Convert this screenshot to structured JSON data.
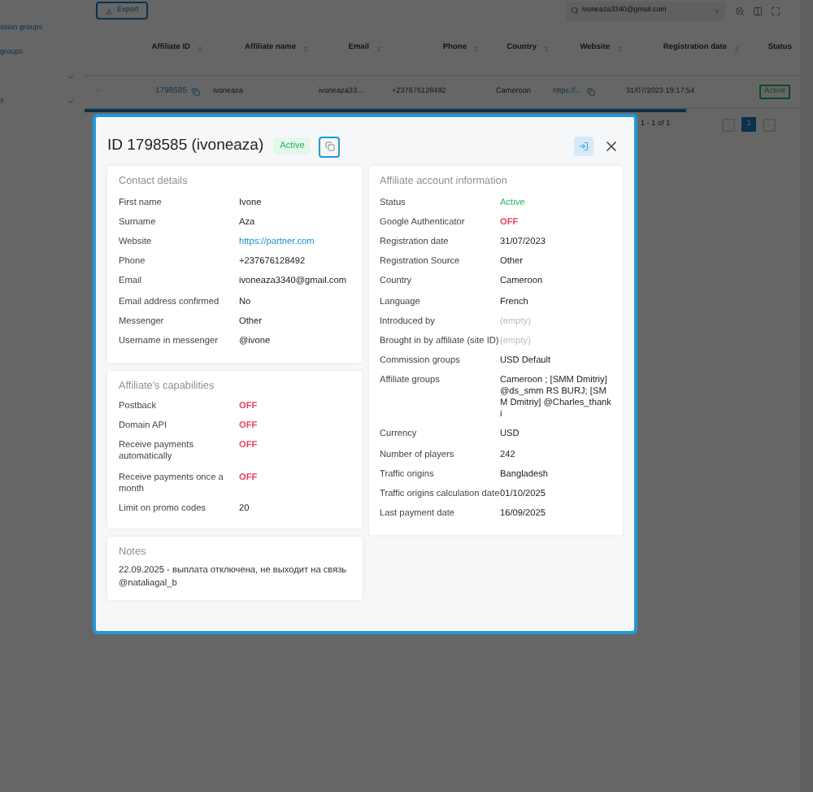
{
  "sidebar": {
    "items": [
      {
        "label": "ssion groups",
        "expandable": false
      },
      {
        "label": "groups",
        "expandable": false
      },
      {
        "expandable": true
      },
      {
        "label": "s",
        "expandable": true
      }
    ]
  },
  "toolbar": {
    "export": "Export",
    "search": {
      "value": "ivoneaza3340@gmail.com"
    }
  },
  "table": {
    "columns": [
      "Affiliate ID",
      "Affiliate name",
      "Email",
      "Phone",
      "Country",
      "Website",
      "Registration date",
      "Status"
    ],
    "rows": [
      {
        "menu": "···",
        "id": "1798585",
        "name": "ivoneaza",
        "email": "ivoneaza33...",
        "phone": "+237676128492",
        "country": "Cameroon",
        "website": "https://...",
        "registration_date": "31/07/2023 19:17:54",
        "status": "Active"
      }
    ]
  },
  "pagination": {
    "range": "1 - 1 of 1",
    "pages": [
      {
        "label": "1",
        "selected": true
      }
    ]
  },
  "modal": {
    "title": "ID 1798585 (ivoneaza)",
    "status": "Active",
    "left_sections": [
      {
        "title": "Contact details",
        "fields": [
          {
            "label": "First name",
            "value": "Ivone",
            "kind": "text"
          },
          {
            "label": "Surname",
            "value": "Aza",
            "kind": "text"
          },
          {
            "label": "Website",
            "value": "https://partner.com",
            "kind": "link"
          },
          {
            "label": "Phone",
            "value": "+237676128492",
            "kind": "text"
          },
          {
            "label": "Email",
            "value": "ivoneaza3340@gmail.com",
            "kind": "text"
          },
          {
            "label": "Email address confirmed",
            "value": "No",
            "kind": "text"
          },
          {
            "label": "Messenger",
            "value": "Other",
            "kind": "text"
          },
          {
            "label": "Username in messenger",
            "value": "@ivone",
            "kind": "text"
          }
        ]
      },
      {
        "title": "Affiliate's capabilities",
        "fields": [
          {
            "label": "Postback",
            "value": "OFF",
            "kind": "off"
          },
          {
            "label": "Domain API",
            "value": "OFF",
            "kind": "off"
          },
          {
            "label": "Receive payments automatically",
            "value": "OFF",
            "kind": "off"
          },
          {
            "label": "Receive payments once a month",
            "value": "OFF",
            "kind": "off"
          },
          {
            "label": "Limit on promo codes",
            "value": "20",
            "kind": "text"
          }
        ]
      },
      {
        "title": "Notes",
        "note": "22.09.2025 - выплата отключена, не выходит на связь @nataliagal_b"
      }
    ],
    "right_sections": [
      {
        "title": "Affiliate account information",
        "fields": [
          {
            "label": "Status",
            "value": "Active",
            "kind": "active"
          },
          {
            "label": "Google Authenticator",
            "value": "OFF",
            "kind": "off"
          },
          {
            "label": "Registration date",
            "value": "31/07/2023",
            "kind": "text"
          },
          {
            "label": "Registration Source",
            "value": "Other",
            "kind": "text"
          },
          {
            "label": "Country",
            "value": "Cameroon",
            "kind": "text"
          },
          {
            "label": "Language",
            "value": "French",
            "kind": "text"
          },
          {
            "label": "Introduced by",
            "value": "(empty)",
            "kind": "empty"
          },
          {
            "label": "Brought in by affiliate (site ID)",
            "value": "(empty)",
            "kind": "empty"
          },
          {
            "label": "Commission groups",
            "value": "USD Default",
            "kind": "text"
          },
          {
            "label": "Affiliate groups",
            "value": "Cameroon ; [SMM Dmitriy] @ds_smm RS BURJ; [SMM Dmitriy] @Charles_thanki",
            "kind": "text"
          },
          {
            "label": "Currency",
            "value": "USD",
            "kind": "text"
          },
          {
            "label": "Number of players",
            "value": "242",
            "kind": "text"
          },
          {
            "label": "Traffic origins",
            "value": "Bangladesh",
            "kind": "text"
          },
          {
            "label": "Traffic origins calculation date",
            "value": "01/10/2025",
            "kind": "text"
          },
          {
            "label": "Last payment date",
            "value": "16/09/2025",
            "kind": "text"
          }
        ]
      }
    ]
  }
}
